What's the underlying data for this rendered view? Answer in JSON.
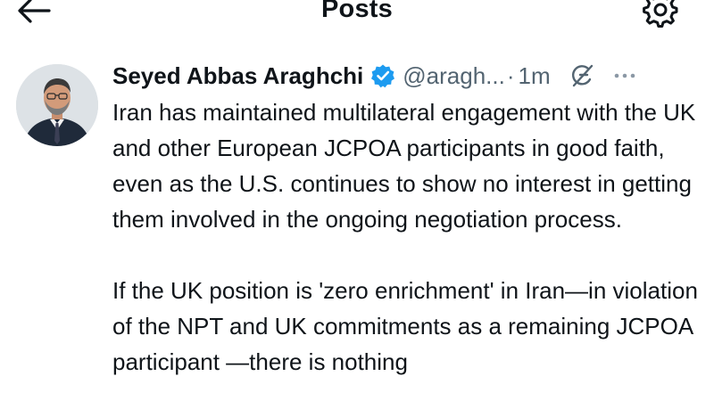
{
  "header": {
    "title": "Posts"
  },
  "post": {
    "author_name": "Seyed Abbas Araghchi",
    "handle": "@aragh...",
    "separator": "·",
    "time": "1m",
    "paragraphs": [
      "Iran has maintained multilateral engagement with the UK and other European JCPOA participants in good faith, even as the U.S. continues to show no interest in getting them involved in the ongoing negotiation process.",
      "If the UK position is 'zero enrichment' in Iran—in violation of the NPT and UK commitments as a remaining JCPOA participant —there is nothing"
    ]
  },
  "icons": {
    "back": "back-arrow-icon",
    "settings": "gear-icon",
    "verified": "verified-badge-icon",
    "grok": "grok-icon",
    "more": "more-options-icon"
  },
  "colors": {
    "verified": "#1d9bf0",
    "secondary_text": "#536471",
    "primary_text": "#0f1419"
  }
}
